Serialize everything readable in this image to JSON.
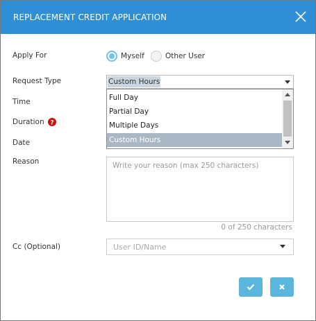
{
  "dialog": {
    "title": "REPLACEMENT CREDIT APPLICATION"
  },
  "form": {
    "apply_for": {
      "label": "Apply For",
      "options": [
        {
          "label": "Myself",
          "selected": true
        },
        {
          "label": "Other User",
          "selected": false
        }
      ]
    },
    "request_type": {
      "label": "Request Type",
      "value": "Custom Hours",
      "options": [
        "Full Day",
        "Partial Day",
        "Multiple Days",
        "Custom Hours"
      ],
      "highlighted": "Custom Hours"
    },
    "time_label": "Time",
    "duration_label": "Duration",
    "date_label": "Date",
    "reason": {
      "label": "Reason",
      "placeholder": "Write your reason (max 250 characters)",
      "counter": "0 of 250 characters"
    },
    "cc": {
      "label": "Cc (Optional)",
      "placeholder": "User ID/Name"
    }
  },
  "colors": {
    "header": "#2f8fd6",
    "accent": "#5ab6dc",
    "radio_on": "#6cc5ea",
    "help_icon": "#cc1111"
  },
  "icons": {
    "close": "close-icon",
    "help": "help-icon",
    "confirm": "check-icon",
    "cancel": "x-icon"
  }
}
